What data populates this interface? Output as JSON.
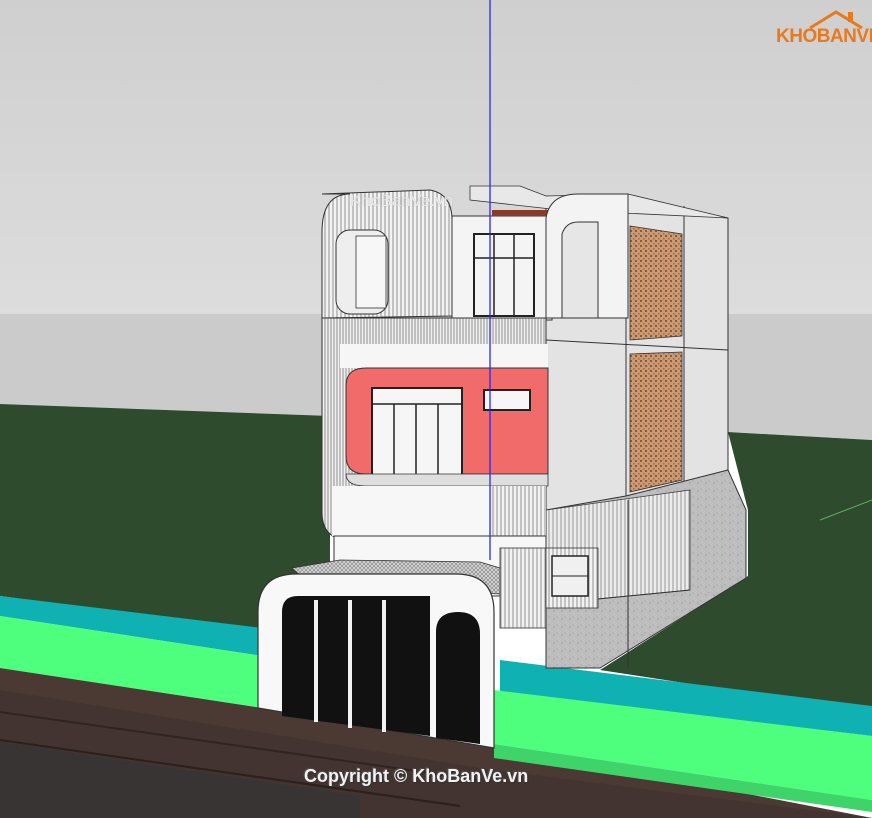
{
  "scene": {
    "type": "3D architectural model render (SketchUp style)",
    "colors": {
      "sky": "#d4d4d4",
      "ground_far": "#c9c9c9",
      "lawn": "#2e4a2c",
      "walkway_green": "#4cff7a",
      "teal_strip": "#10aeb0",
      "road": "#4a3a34",
      "facade_white": "#f5f5f5",
      "accent_red": "#f06a6a",
      "side_gray": "#e0e0e0",
      "brick_panel": "#b07a54",
      "axis_blue": "#2222ff"
    }
  },
  "watermarks": {
    "top_text": "KhoBanVe.vn",
    "logo_part1": "KHO",
    "logo_part2": "BANVE",
    "copyright": "Copyright © KhoBanVe.vn"
  }
}
